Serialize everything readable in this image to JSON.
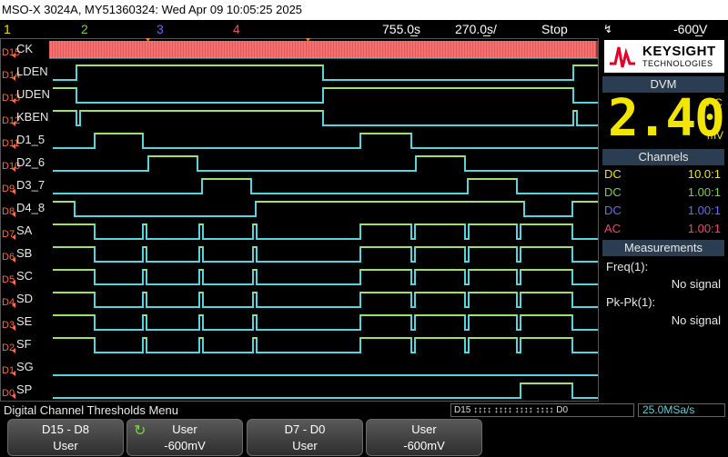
{
  "title_bar": {
    "text": "MSO-X 3024A, MY51360324: Wed Apr 09 10:05:25 2025"
  },
  "status": {
    "channels": [
      "1",
      "2",
      "3",
      "4"
    ],
    "channel_colors": [
      "#f2e600",
      "#7ad14a",
      "#6a6cf0",
      "#ff3f74"
    ],
    "timebase": "755.0̲s",
    "delay": "270.0̲s/",
    "run_state": "Stop",
    "trigger_level": "-600̲V"
  },
  "channels": [
    {
      "id": "D15",
      "label": "CK"
    },
    {
      "id": "D14",
      "label": "LDEN"
    },
    {
      "id": "D13",
      "label": "UDEN"
    },
    {
      "id": "D12",
      "label": "KBEN"
    },
    {
      "id": "D11",
      "label": "D1_5"
    },
    {
      "id": "D10",
      "label": "D2_6"
    },
    {
      "id": "D9",
      "label": "D3_7"
    },
    {
      "id": "D8",
      "label": "D4_8"
    },
    {
      "id": "D7",
      "label": "SA"
    },
    {
      "id": "D6",
      "label": "SB"
    },
    {
      "id": "D5",
      "label": "SC"
    },
    {
      "id": "D4",
      "label": "SD"
    },
    {
      "id": "D3",
      "label": "SE"
    },
    {
      "id": "D2",
      "label": "SF"
    },
    {
      "id": "D1",
      "label": "SG"
    },
    {
      "id": "D0",
      "label": "SP"
    }
  ],
  "brand": {
    "name": "KEYSIGHT",
    "sub": "TECHNOLOGIES"
  },
  "dvm": {
    "heading": "DVM",
    "value": "2.40",
    "coupling": "AC",
    "unit": "mV"
  },
  "channel_panel": {
    "heading": "Channels",
    "rows": [
      {
        "coupling": "DC",
        "ratio": "10.0:1",
        "color": "#f2e600"
      },
      {
        "coupling": "DC",
        "ratio": "1.00:1",
        "color": "#7ad14a"
      },
      {
        "coupling": "DC",
        "ratio": "1.00:1",
        "color": "#6a6cf0"
      },
      {
        "coupling": "AC",
        "ratio": "1.00:1",
        "color": "#ff3f74"
      }
    ]
  },
  "measurements": {
    "heading": "Measurements",
    "items": [
      {
        "label": "Freq(1):",
        "value": "No signal"
      },
      {
        "label": "Pk-Pk(1):",
        "value": "No signal"
      }
    ]
  },
  "menu": {
    "title": "Digital Channel Thresholds Menu",
    "activity_label": "D15 ↕↕↕↕ ↕↕↕↕ ↕↕↕↕ ↕↕↕↕ D0",
    "sample_rate": "25.0MSa/s"
  },
  "softkeys": [
    {
      "top": "D15 - D8",
      "bottom": "User"
    },
    {
      "top": "User",
      "bottom": "-600mV"
    },
    {
      "top": "D7 - D0",
      "bottom": "User"
    },
    {
      "top": "User",
      "bottom": "-600mV"
    }
  ]
}
